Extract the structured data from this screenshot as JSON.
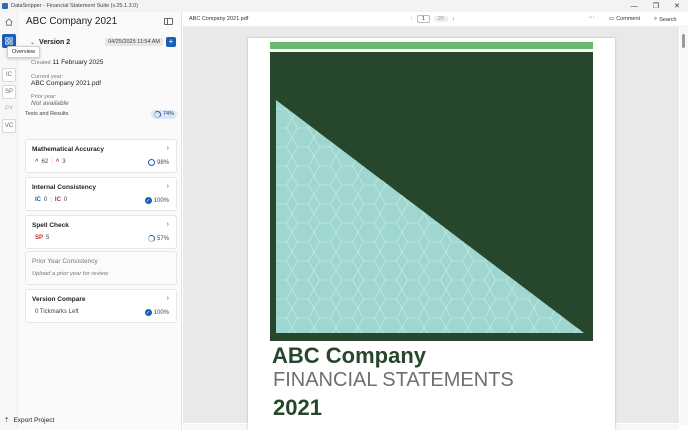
{
  "window": {
    "title": "DataSnipper - Financial Statement Suite (v.25.1.3.0)"
  },
  "rail": {
    "items": [
      {
        "label": ""
      },
      {
        "label": ""
      },
      {
        "label": "IC"
      },
      {
        "label": "SP"
      },
      {
        "label": "PY"
      },
      {
        "label": "VC"
      }
    ],
    "tooltip": "Overview"
  },
  "project": {
    "title": "ABC Company 2021",
    "version_label": "Version 2",
    "version_date": "04/25/2025 11:54 AM",
    "created_label": "Created",
    "created_value": "11 February 2025",
    "current_year_label": "Current year:",
    "current_year_value": "ABC Company 2021.pdf",
    "prior_year_label": "Prior year:",
    "prior_year_value": "Not available"
  },
  "tests": {
    "label": "Tests and Results",
    "percent": "74%",
    "cards": [
      {
        "title": "Mathematical Accuracy",
        "left_a": "62",
        "left_b": "3",
        "percent": "98%"
      },
      {
        "title": "Internal Consistency",
        "tag_a": "IC",
        "left_a": "0",
        "tag_b": "IC",
        "left_b": "0",
        "percent": "100%"
      },
      {
        "title": "Spell Check",
        "tag": "SP",
        "left": "5",
        "percent": "57%"
      },
      {
        "title": "Prior Year Consistency",
        "subtitle": "Upload a prior year for review"
      },
      {
        "title": "Version Compare",
        "left": "0 Tickmarks Left",
        "percent": "100%"
      }
    ]
  },
  "footer": {
    "export_label": "Export Project"
  },
  "toolbar": {
    "doc_name": "ABC Company 2021.pdf",
    "page_current": "1",
    "page_total": "26",
    "more": "···",
    "comment_label": "Comment",
    "search_label": "Search"
  },
  "document": {
    "heading": "ABC Company",
    "subheading": "FINANCIAL STATEMENTS",
    "year": "2021"
  },
  "colors": {
    "accent": "#1a5fb4",
    "cover_dark": "#26472c",
    "cover_stripe": "#6ab96e",
    "cover_triangle": "#9fd6cf"
  }
}
